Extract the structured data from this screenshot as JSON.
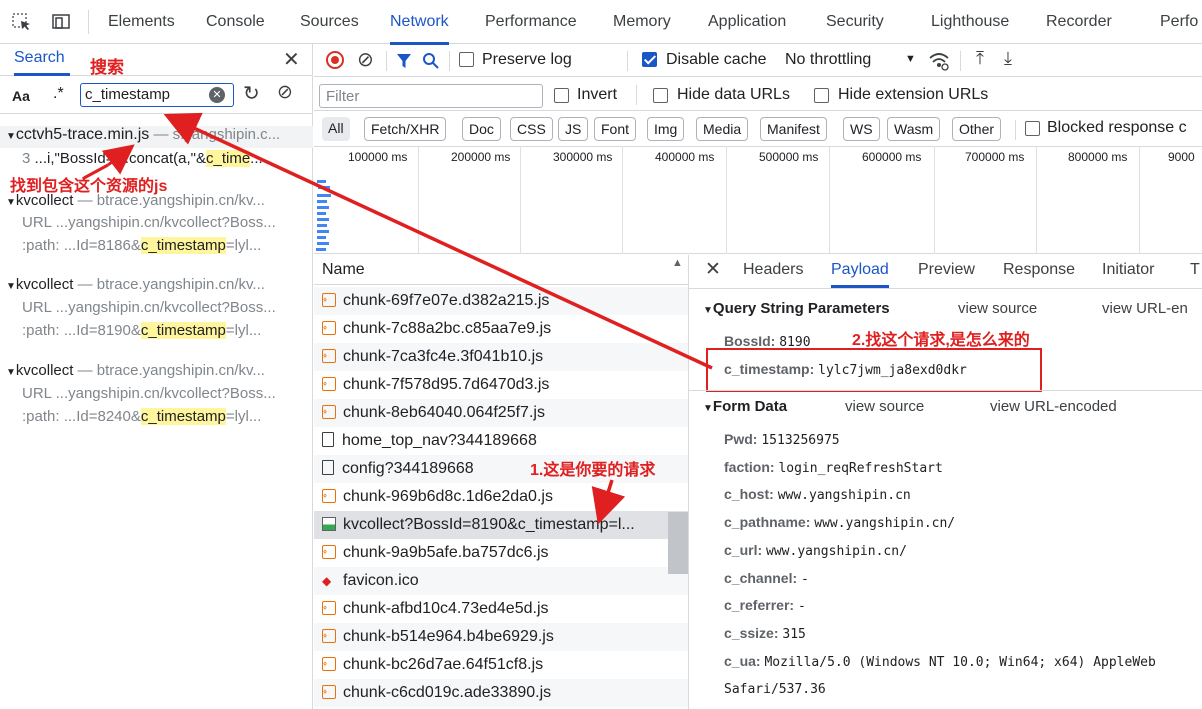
{
  "tabs": [
    "Elements",
    "Console",
    "Sources",
    "Network",
    "Performance",
    "Memory",
    "Application",
    "Security",
    "Lighthouse",
    "Recorder",
    "Perfo"
  ],
  "search": {
    "title": "Search",
    "annotation": "搜索",
    "case_btn": "Aa",
    "regex_btn": ".*",
    "query": "c_timestamp",
    "results": [
      {
        "file": "cctvh5-trace.min.js",
        "host": "s.yangshipin.c...",
        "line_no": "3",
        "line_pre": "...i,\"BossId=\").concat(a,\"&",
        "line_hl": "c_time",
        "line_post": "..."
      },
      {
        "file": "kvcollect",
        "host": "btrace.yangshipin.cn/kv...",
        "url_label": "URL",
        "url": "...yangshipin.cn/kvcollect?Boss...",
        "path_label": ":path:",
        "path_pre": "...Id=8186&",
        "path_hl": "c_timestamp",
        "path_post": "=lyl..."
      },
      {
        "file": "kvcollect",
        "host": "btrace.yangshipin.cn/kv...",
        "url_label": "URL",
        "url": "...yangshipin.cn/kvcollect?Boss...",
        "path_label": ":path:",
        "path_pre": "...Id=8190&",
        "path_hl": "c_timestamp",
        "path_post": "=lyl..."
      },
      {
        "file": "kvcollect",
        "host": "btrace.yangshipin.cn/kv...",
        "url_label": "URL",
        "url": "...yangshipin.cn/kvcollect?Boss...",
        "path_label": ":path:",
        "path_pre": "...Id=8240&",
        "path_hl": "c_timestamp",
        "path_post": "=lyl..."
      }
    ],
    "annotation_js": "找到包含这个资源的js"
  },
  "toolbar": {
    "preserve_log": "Preserve log",
    "disable_cache": "Disable cache",
    "throttling": "No throttling"
  },
  "filter": {
    "placeholder": "Filter",
    "invert": "Invert",
    "hide_data": "Hide data URLs",
    "hide_ext": "Hide extension URLs",
    "types": [
      "All",
      "Fetch/XHR",
      "Doc",
      "CSS",
      "JS",
      "Font",
      "Img",
      "Media",
      "Manifest",
      "WS",
      "Wasm",
      "Other"
    ],
    "blocked": "Blocked response c"
  },
  "timeline": [
    "100000 ms",
    "200000 ms",
    "300000 ms",
    "400000 ms",
    "500000 ms",
    "600000 ms",
    "700000 ms",
    "800000 ms",
    "9000"
  ],
  "requests": {
    "header": "Name",
    "items": [
      {
        "name": "chunk-69f7e07e.d382a215.js",
        "type": "js"
      },
      {
        "name": "chunk-7c88a2bc.c85aa7e9.js",
        "type": "js"
      },
      {
        "name": "chunk-7ca3fc4e.3f041b10.js",
        "type": "js"
      },
      {
        "name": "chunk-7f578d95.7d6470d3.js",
        "type": "js"
      },
      {
        "name": "chunk-8eb64040.064f25f7.js",
        "type": "js"
      },
      {
        "name": "home_top_nav?344189668",
        "type": "doc"
      },
      {
        "name": "config?344189668",
        "type": "doc"
      },
      {
        "name": "chunk-969b6d8c.1d6e2da0.js",
        "type": "js"
      },
      {
        "name": "kvcollect?BossId=8190&c_timestamp=l...",
        "type": "img"
      },
      {
        "name": "chunk-9a9b5afe.ba757dc6.js",
        "type": "js"
      },
      {
        "name": "favicon.ico",
        "type": "fav"
      },
      {
        "name": "chunk-afbd10c4.73ed4e5d.js",
        "type": "js"
      },
      {
        "name": "chunk-b514e964.b4be6929.js",
        "type": "js"
      },
      {
        "name": "chunk-bc26d7ae.64f51cf8.js",
        "type": "js"
      },
      {
        "name": "chunk-c6cd019c.ade33890.js",
        "type": "js"
      }
    ],
    "annotation": "1.这是你要的请求"
  },
  "details": {
    "tabs": [
      "Headers",
      "Payload",
      "Preview",
      "Response",
      "Initiator",
      "T"
    ],
    "qs_title": "Query String Parameters",
    "view_source": "view source",
    "view_url": "view URL-en",
    "qs": [
      {
        "key": "BossId:",
        "value": "8190"
      },
      {
        "key": "c_timestamp:",
        "value": "lylc7jwm_ja8exd0dkr"
      }
    ],
    "annotation": "2.找这个请求,是怎么来的",
    "form_title": "Form Data",
    "form_view_source": "view source",
    "form_view_url": "view URL-encoded",
    "form": [
      {
        "key": "Pwd:",
        "value": "1513256975"
      },
      {
        "key": "faction:",
        "value": "login_reqRefreshStart"
      },
      {
        "key": "c_host:",
        "value": "www.yangshipin.cn"
      },
      {
        "key": "c_pathname:",
        "value": "www.yangshipin.cn/"
      },
      {
        "key": "c_url:",
        "value": "www.yangshipin.cn/"
      },
      {
        "key": "c_channel:",
        "value": "-"
      },
      {
        "key": "c_referrer:",
        "value": "-"
      },
      {
        "key": "c_ssize:",
        "value": "315"
      },
      {
        "key": "c_ua:",
        "value": "Mozilla/5.0 (Windows NT 10.0; Win64; x64) AppleWeb"
      }
    ],
    "ua_cont": "Safari/537.36"
  },
  "colors": {
    "accent": "#1a56c6",
    "annotation": "#e02020",
    "highlight": "#fff59d"
  }
}
